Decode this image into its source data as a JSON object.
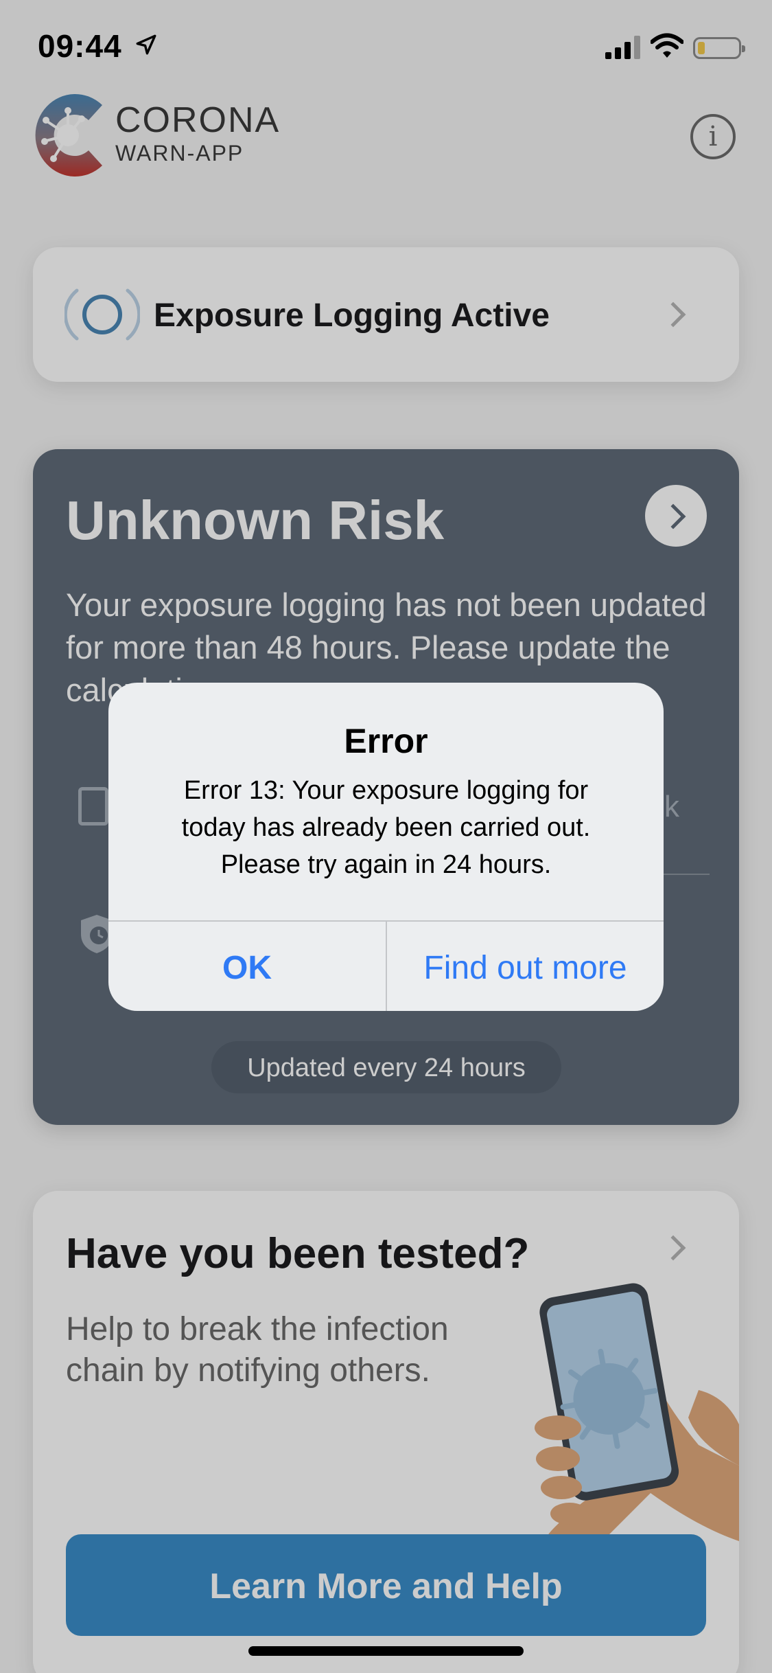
{
  "status_bar": {
    "time": "09:44"
  },
  "header": {
    "brand_title": "CORONA",
    "brand_subtitle": "WARN-APP"
  },
  "exposure": {
    "label": "Exposure Logging Active"
  },
  "risk_card": {
    "title": "Unknown Risk",
    "description": "Your exposure logging has not been updated for more than 48 hours. Please update the calculation.",
    "row_text": "k",
    "updated_label": "Updated every 24 hours"
  },
  "tested_card": {
    "title": "Have you been tested?",
    "description": "Help to break the infection chain by notifying others.",
    "button_label": "Learn More and Help"
  },
  "alert": {
    "title": "Error",
    "message": "Error 13: Your exposure logging for today has already been carried out. Please try again in 24 hours.",
    "ok_label": "OK",
    "more_label": "Find out more"
  },
  "colors": {
    "risk_background": "#5f6b79",
    "button_blue": "#3a8dc8",
    "alert_link": "#2f7af5",
    "logo_blue": "#4a86b5",
    "logo_red": "#c2352e"
  },
  "icons": [
    "location-arrow-icon",
    "signal-icon",
    "wifi-icon",
    "battery-icon",
    "info-icon",
    "exposure-logging-icon",
    "chevron-right-icon",
    "calendar-icon",
    "shield-clock-icon"
  ]
}
